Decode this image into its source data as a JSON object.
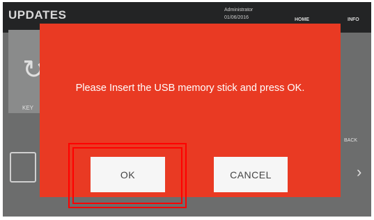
{
  "header": {
    "title": "UPDATES",
    "user_info": "Administrator\n01/06/2016",
    "home_label": "HOME",
    "info_label": "INFO"
  },
  "background": {
    "key_label": "KEY",
    "back_label": "BACK"
  },
  "dialog": {
    "message": "Please Insert the USB memory stick and press OK.",
    "ok_label": "OK",
    "cancel_label": "CANCEL",
    "background_color": "#e93a23"
  },
  "annotation": {
    "highlight_color": "#ff0000"
  }
}
